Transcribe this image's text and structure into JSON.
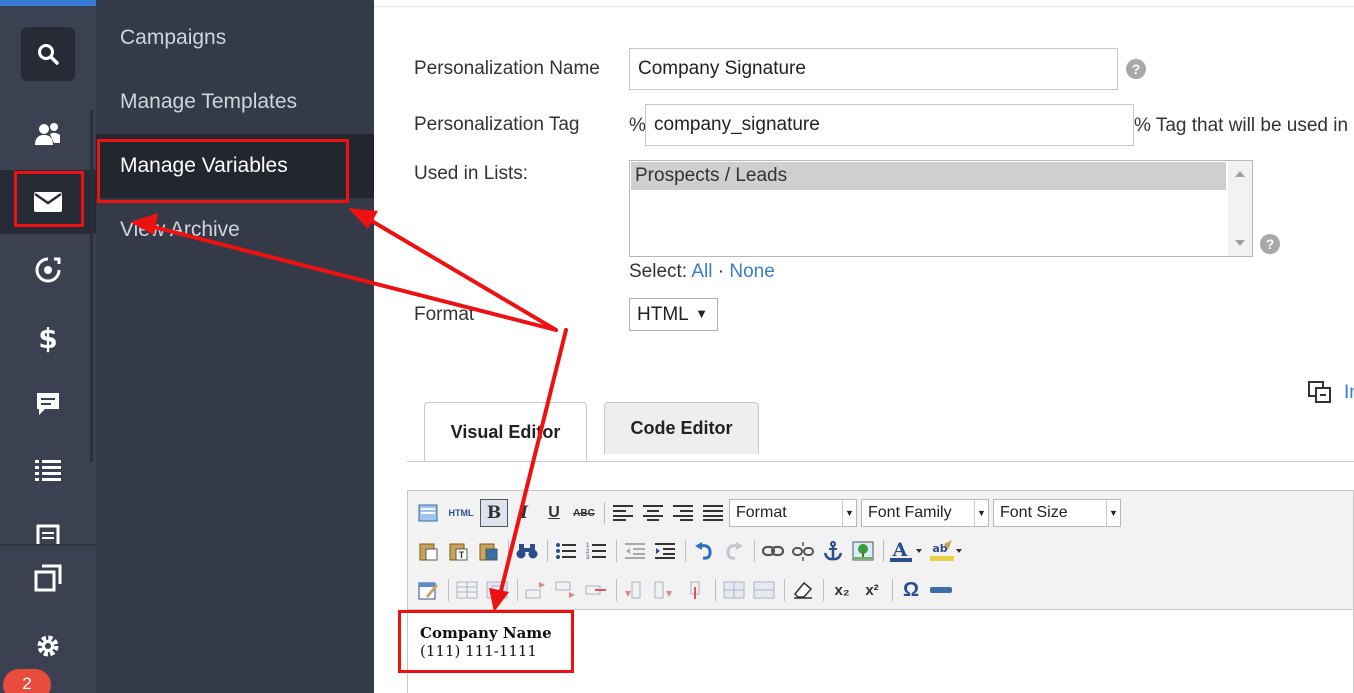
{
  "rail": {
    "icons": [
      "search-icon",
      "contacts-icon",
      "email-icon",
      "automation-icon",
      "dollar-icon",
      "chat-icon",
      "list-icon",
      "document-icon",
      "pages-icon",
      "gear-icon"
    ],
    "badge": "2"
  },
  "subnav": {
    "items": [
      {
        "label": "Campaigns",
        "active": false
      },
      {
        "label": "Manage Templates",
        "active": false
      },
      {
        "label": "Manage Variables",
        "active": true
      },
      {
        "label": "View Archive",
        "active": false
      }
    ]
  },
  "form": {
    "name_label": "Personalization Name",
    "name_value": "Company Signature",
    "tag_label": "Personalization Tag",
    "tag_prefix": "%",
    "tag_value": "company_signature",
    "tag_note": "% Tag that will be used in",
    "lists_label": "Used in Lists:",
    "lists_selected": "Prospects / Leads",
    "select_label": "Select:",
    "select_all": "All",
    "select_dot": "·",
    "select_none": "None",
    "format_label": "Format",
    "format_value": "HTML",
    "help": "?",
    "insert_link": "In"
  },
  "tabs": [
    {
      "label": "Visual Editor",
      "active": true
    },
    {
      "label": "Code Editor",
      "active": false
    }
  ],
  "editor": {
    "format_dd": "Format",
    "font_family_dd": "Font Family",
    "font_size_dd": "Font Size",
    "html_btn": "HTML",
    "bold": "B",
    "italic": "I",
    "underline": "U",
    "strike": "ABC",
    "subscript": "x₂",
    "superscript": "x²",
    "omega": "Ω",
    "content_line1": "Company Name",
    "content_line2": "(111) 111-1111"
  },
  "colors": {
    "annotation": "#ee1111",
    "accent": "#3a7bd5",
    "rail_bg": "#3b4150",
    "subnav_bg": "#343a48"
  }
}
